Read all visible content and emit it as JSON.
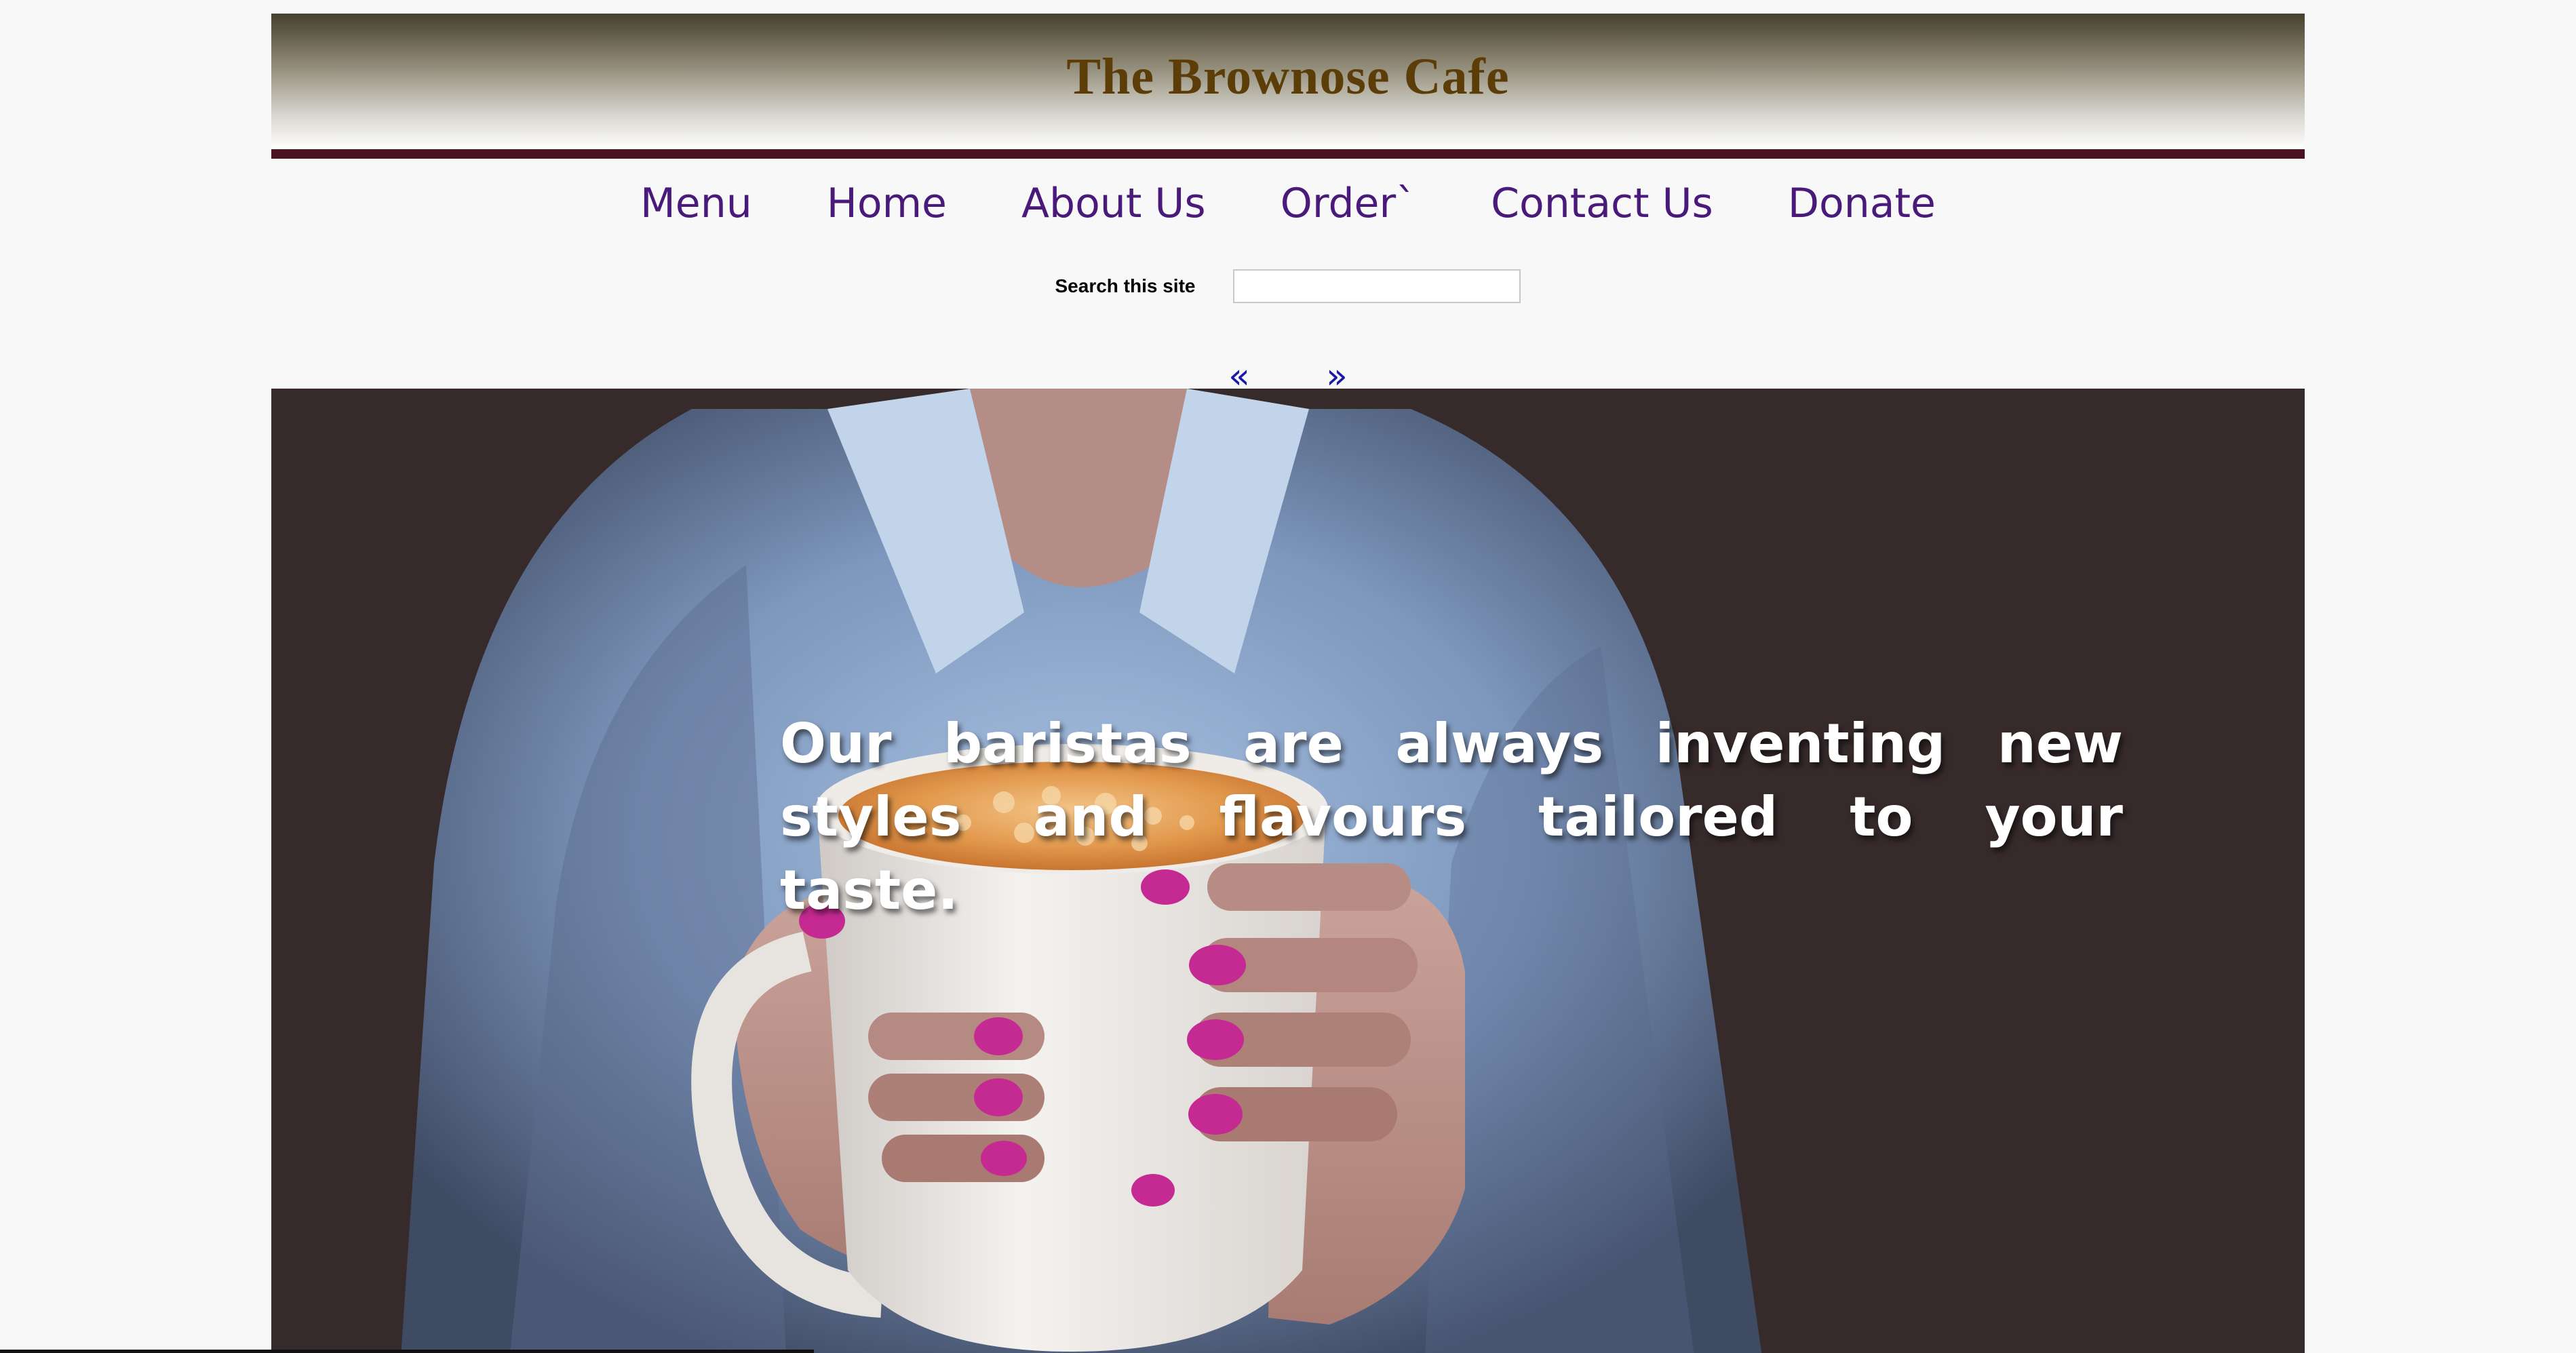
{
  "site": {
    "title": "The Brownose Cafe"
  },
  "nav": {
    "items": [
      {
        "label": "Menu"
      },
      {
        "label": "Home"
      },
      {
        "label": "About Us"
      },
      {
        "label": "Order`"
      },
      {
        "label": "Contact Us"
      },
      {
        "label": "Donate"
      }
    ]
  },
  "search": {
    "label": "Search this site",
    "value": "",
    "placeholder": ""
  },
  "pager": {
    "prev": "«",
    "next": "»"
  },
  "hero": {
    "caption": "Our baristas are always inventing new styles and flavours tailored to your taste."
  },
  "colors": {
    "title": "#5c3d08",
    "nav_link": "#4a1a7a",
    "header_rule": "#4a1322",
    "pager_link": "#1a1aa6",
    "hero_background": "#3a2b2c"
  }
}
